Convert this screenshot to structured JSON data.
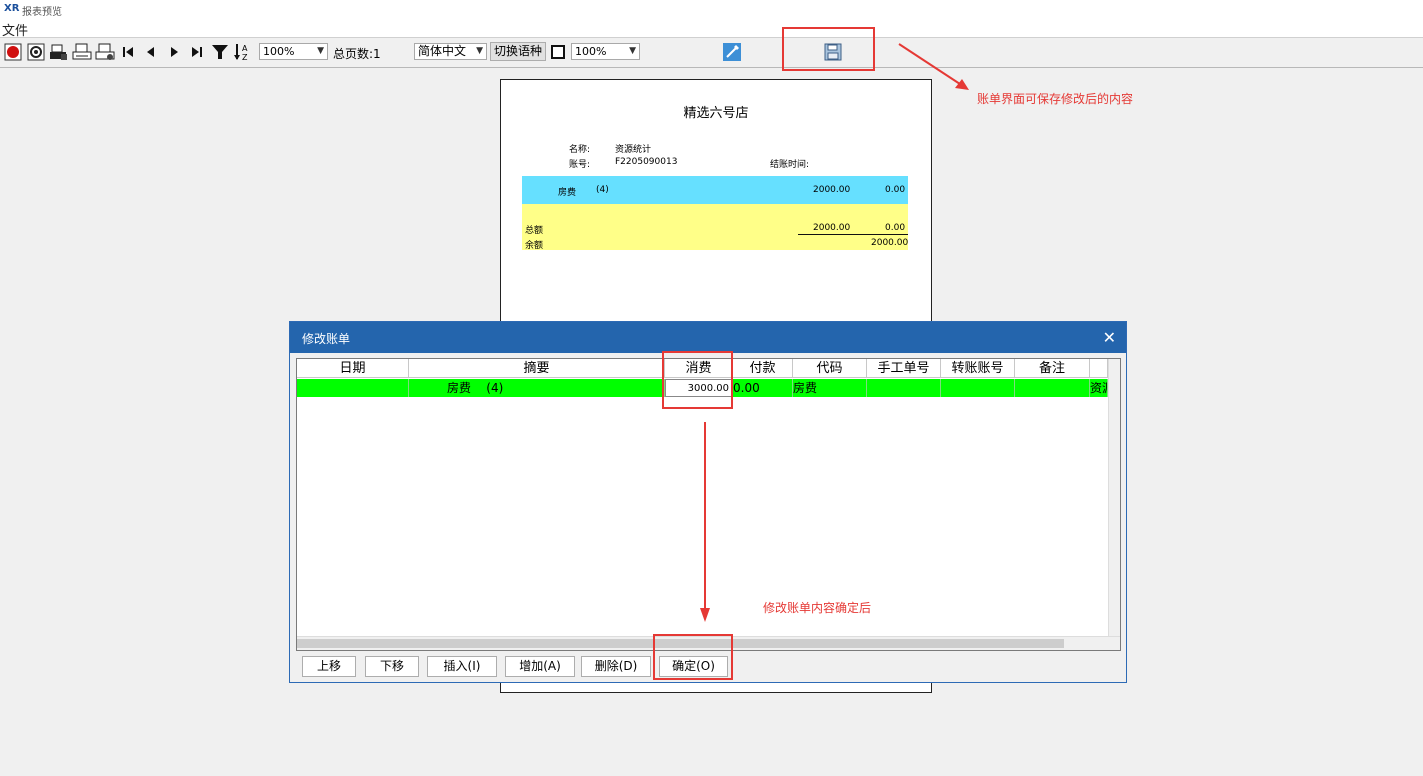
{
  "window": {
    "logo": "XR",
    "title": "报表预览",
    "menu_file": "文件"
  },
  "toolbar": {
    "zoom_value": "100%",
    "total_pages_label": "总页数:1",
    "language_value": "简体中文",
    "switch_language_label": "切换语种",
    "zoom2_value": "100%"
  },
  "annotations": {
    "save_note": "账单界面可保存修改后的内容",
    "confirm_note": "修改账单内容确定后"
  },
  "report": {
    "shop_title": "精选六号店",
    "name_label": "名称:",
    "name_value": "资源统计",
    "account_label": "账号:",
    "account_value": "F2205090013",
    "checkout_time_label": "结账时间:",
    "row_item": "房费",
    "row_count": "(4)",
    "row_amount": "2000.00",
    "row_paid": "0.00",
    "total_label": "总额",
    "total_amount": "2000.00",
    "total_paid": "0.00",
    "balance_label": "余额",
    "balance_amount": "2000.00"
  },
  "dialog": {
    "title": "修改账单",
    "columns": [
      "日期",
      "摘要",
      "消费",
      "付款",
      "代码",
      "手工单号",
      "转账账号",
      "备注"
    ],
    "row": {
      "date": "",
      "summary": "房费    (4)",
      "consume_edit": "3000.00",
      "payment": "0.00",
      "code": "房费",
      "manual_no": "",
      "transfer_acct": "",
      "remark": "",
      "extra": "资源"
    },
    "buttons": {
      "up": "上移",
      "down": "下移",
      "insert": "插入(I)",
      "add": "增加(A)",
      "delete": "删除(D)",
      "confirm": "确定(O)"
    }
  },
  "colors": {
    "row_highlight": "#00ff00",
    "report_blue": "#66e0ff",
    "report_yellow": "#ffff88",
    "annotation_red": "#e53935",
    "dialog_title": "#2465ad"
  }
}
